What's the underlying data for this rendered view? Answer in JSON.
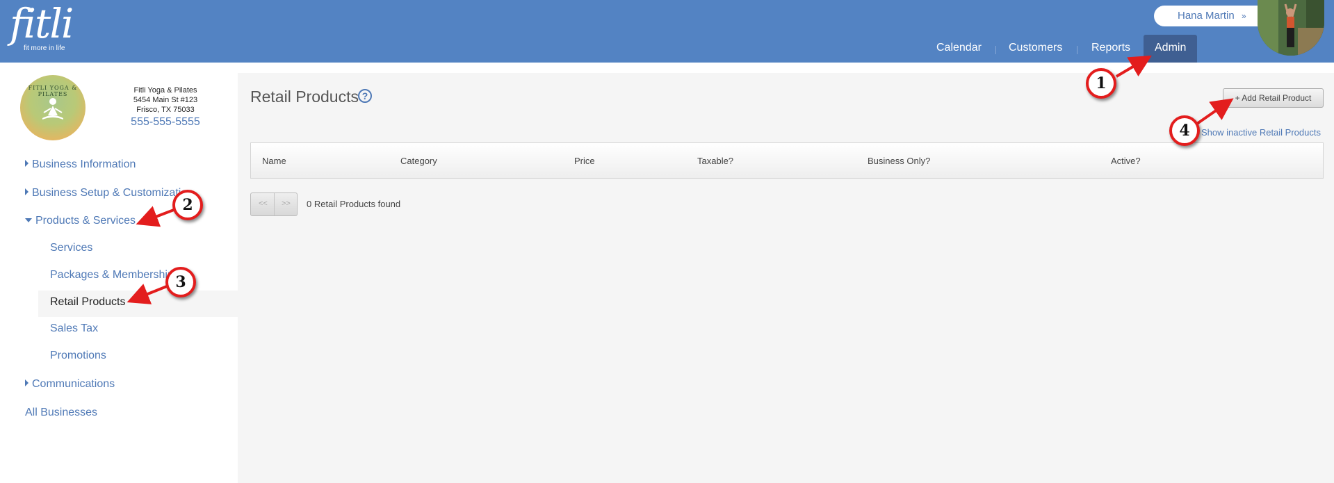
{
  "header": {
    "logo_text": "fitli",
    "logo_tagline": "fit more in life",
    "user_name": "Hana Martin",
    "user_chevron": "»",
    "nav": [
      {
        "label": "Calendar"
      },
      {
        "label": "Customers"
      },
      {
        "label": "Reports"
      },
      {
        "label": "Admin",
        "active": true
      }
    ]
  },
  "business": {
    "logo_text": "FITLI YOGA & PILATES",
    "name": "Fitli Yoga & Pilates",
    "address1": "5454 Main St #123",
    "address2": "Frisco, TX 75033",
    "phone": "555-555-5555"
  },
  "sidebar": {
    "items": [
      {
        "label": "Business Information",
        "expanded": false
      },
      {
        "label": "Business Setup & Customization",
        "expanded": false
      },
      {
        "label": "Products & Services",
        "expanded": true
      },
      {
        "label": "Services"
      },
      {
        "label": "Packages & Memberships"
      },
      {
        "label": "Retail Products",
        "active": true
      },
      {
        "label": "Sales Tax"
      },
      {
        "label": "Promotions"
      },
      {
        "label": "Communications",
        "expanded": false
      },
      {
        "label": "All Businesses"
      }
    ]
  },
  "main": {
    "title": "Retail Products",
    "help_icon": "?",
    "add_button": "+ Add Retail Product",
    "show_inactive": "Show inactive Retail Products",
    "columns": [
      "Name",
      "Category",
      "Price",
      "Taxable?",
      "Business Only?",
      "Active?"
    ],
    "pager_prev": "<<",
    "pager_next": ">>",
    "found_text": "0 Retail Products found"
  },
  "annotations": {
    "markers": [
      "1",
      "2",
      "3",
      "4"
    ],
    "color": "#e31d1d"
  },
  "colors": {
    "header": "#5383c3",
    "nav_active": "#3f5f92",
    "link": "#4f79b6",
    "panel": "#f5f5f5"
  }
}
